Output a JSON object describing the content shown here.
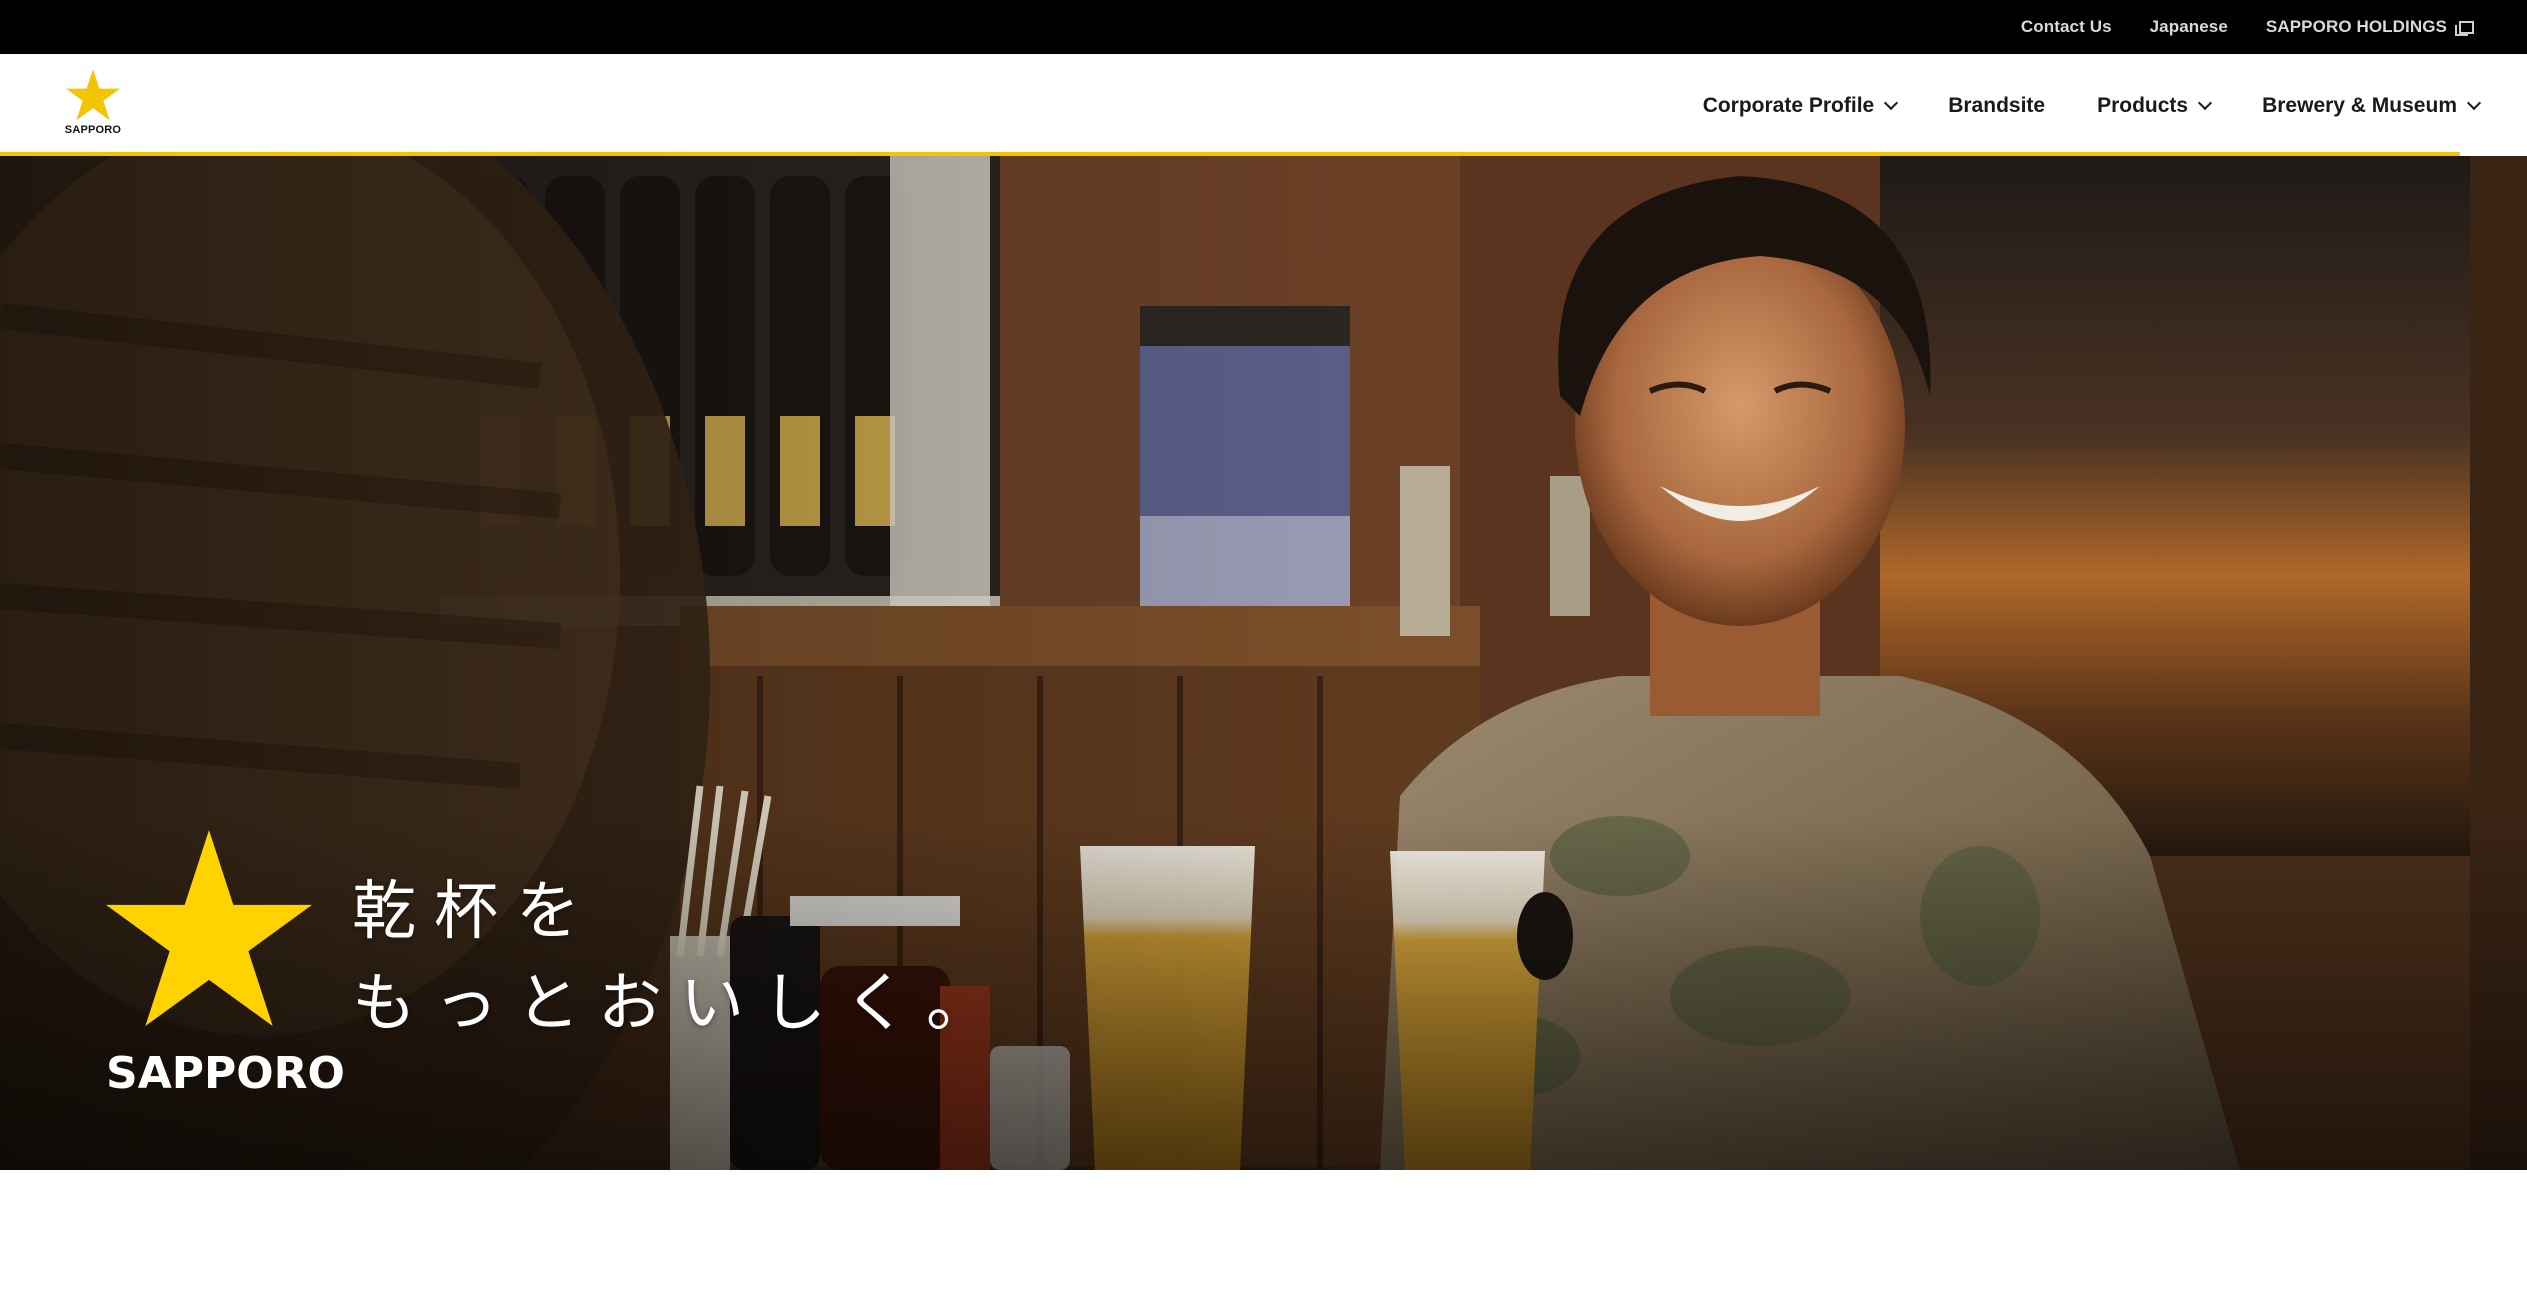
{
  "utility_bar": {
    "links": [
      {
        "label": "Contact Us"
      },
      {
        "label": "Japanese"
      },
      {
        "label": "SAPPORO HOLDINGS",
        "icon": "external-link-icon"
      }
    ]
  },
  "header": {
    "logo_text": "SAPPORO",
    "nav": [
      {
        "label": "Corporate Profile",
        "icon": "chevron-down-icon"
      },
      {
        "label": "Brandsite"
      },
      {
        "label": "Products",
        "icon": "chevron-down-icon"
      },
      {
        "label": "Brewery & Museum",
        "icon": "chevron-down-icon"
      }
    ]
  },
  "hero": {
    "brand_text": "SAPPORO",
    "tagline_line1": "乾杯を",
    "tagline_line2": "もっとおいしく。"
  },
  "colors": {
    "accent": "#f5c400",
    "star": "#ffd200",
    "utility_bg": "#000000",
    "header_bg": "#ffffff"
  }
}
